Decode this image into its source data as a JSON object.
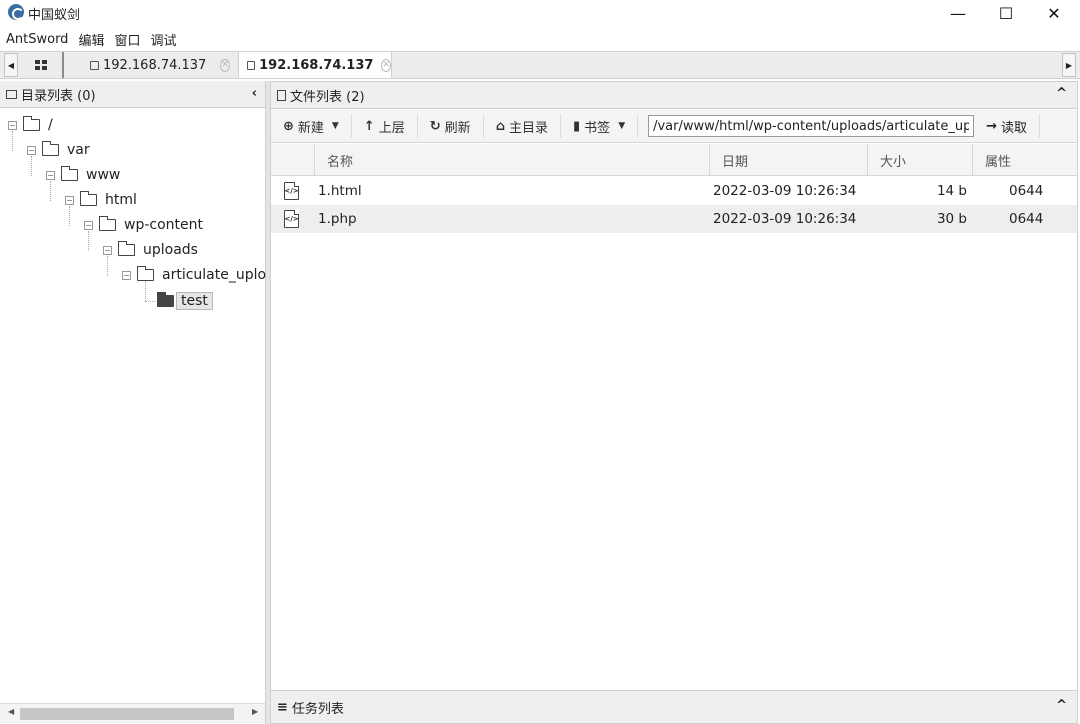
{
  "window": {
    "title": "中国蚁剑",
    "minimize_glyph": "—",
    "maximize_glyph": "☐",
    "close_glyph": "✕"
  },
  "menu": [
    "AntSword",
    "编辑",
    "窗口",
    "调试"
  ],
  "tabs": [
    {
      "label": "192.168.74.137",
      "active": false
    },
    {
      "label": "192.168.74.137",
      "active": true
    }
  ],
  "dir_panel": {
    "title": "目录列表 (0)",
    "tree": [
      {
        "label": "/",
        "expanded": true
      },
      {
        "label": "var",
        "expanded": true
      },
      {
        "label": "www",
        "expanded": true
      },
      {
        "label": "html",
        "expanded": true
      },
      {
        "label": "wp-content",
        "expanded": true
      },
      {
        "label": "uploads",
        "expanded": true
      },
      {
        "label": "articulate_upload",
        "expanded": true
      },
      {
        "label": "test",
        "selected": true
      }
    ]
  },
  "file_panel": {
    "title": "文件列表 (2)",
    "toolbar": {
      "new_label": "新建",
      "up_label": "上层",
      "refresh_label": "刷新",
      "home_label": "主目录",
      "bookmark_label": "书签",
      "path_value": "/var/www/html/wp-content/uploads/articulate_uploads/t",
      "read_label": "读取"
    },
    "columns": [
      "名称",
      "日期",
      "大小",
      "属性"
    ],
    "rows": [
      {
        "name": "1.html",
        "date": "2022-03-09 10:26:34",
        "size": "14 b",
        "perm": "0644"
      },
      {
        "name": "1.php",
        "date": "2022-03-09 10:26:34",
        "size": "30 b",
        "perm": "0644"
      }
    ]
  },
  "task_panel": {
    "title": "任务列表"
  }
}
